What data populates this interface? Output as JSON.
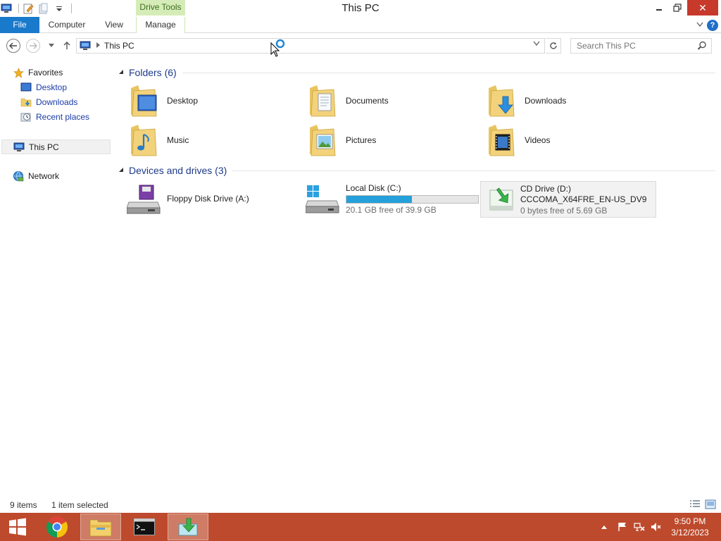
{
  "window": {
    "title": "This PC",
    "context_tab_group": "Drive Tools",
    "close_glyph": "✕"
  },
  "ribbon": {
    "tabs": [
      "File",
      "Computer",
      "View",
      "Manage"
    ]
  },
  "address": {
    "location": "This PC",
    "search_placeholder": "Search This PC"
  },
  "navpane": {
    "favorites": "Favorites",
    "favorite_items": [
      "Desktop",
      "Downloads",
      "Recent places"
    ],
    "this_pc": "This PC",
    "network": "Network"
  },
  "folders": {
    "header": "Folders (6)",
    "items": [
      {
        "name": "Desktop",
        "icon": "desktop-folder-icon"
      },
      {
        "name": "Documents",
        "icon": "documents-folder-icon"
      },
      {
        "name": "Downloads",
        "icon": "downloads-folder-icon"
      },
      {
        "name": "Music",
        "icon": "music-folder-icon"
      },
      {
        "name": "Pictures",
        "icon": "pictures-folder-icon"
      },
      {
        "name": "Videos",
        "icon": "videos-folder-icon"
      }
    ]
  },
  "drives": {
    "header": "Devices and drives (3)",
    "items": [
      {
        "name": "Floppy Disk Drive (A:)",
        "icon": "floppy-drive-icon"
      },
      {
        "name": "Local Disk (C:)",
        "free": "20.1 GB free of 39.9 GB",
        "used_fraction": 0.496,
        "icon": "local-disk-icon"
      },
      {
        "name": "CD Drive (D:)",
        "label": "CCCOMA_X64FRE_EN-US_DV9",
        "free": "0 bytes free of 5.69 GB",
        "icon": "cd-drive-icon"
      }
    ]
  },
  "status": {
    "item_count": "9 items",
    "selection": "1 item selected"
  },
  "clock": {
    "time": "9:50 PM",
    "date": "3/12/2023"
  },
  "colors": {
    "accent": "#1979ca",
    "taskbar": "#bd4a2c",
    "drive_bar": "#26a0da",
    "context_tab": "#d6ecb8"
  }
}
